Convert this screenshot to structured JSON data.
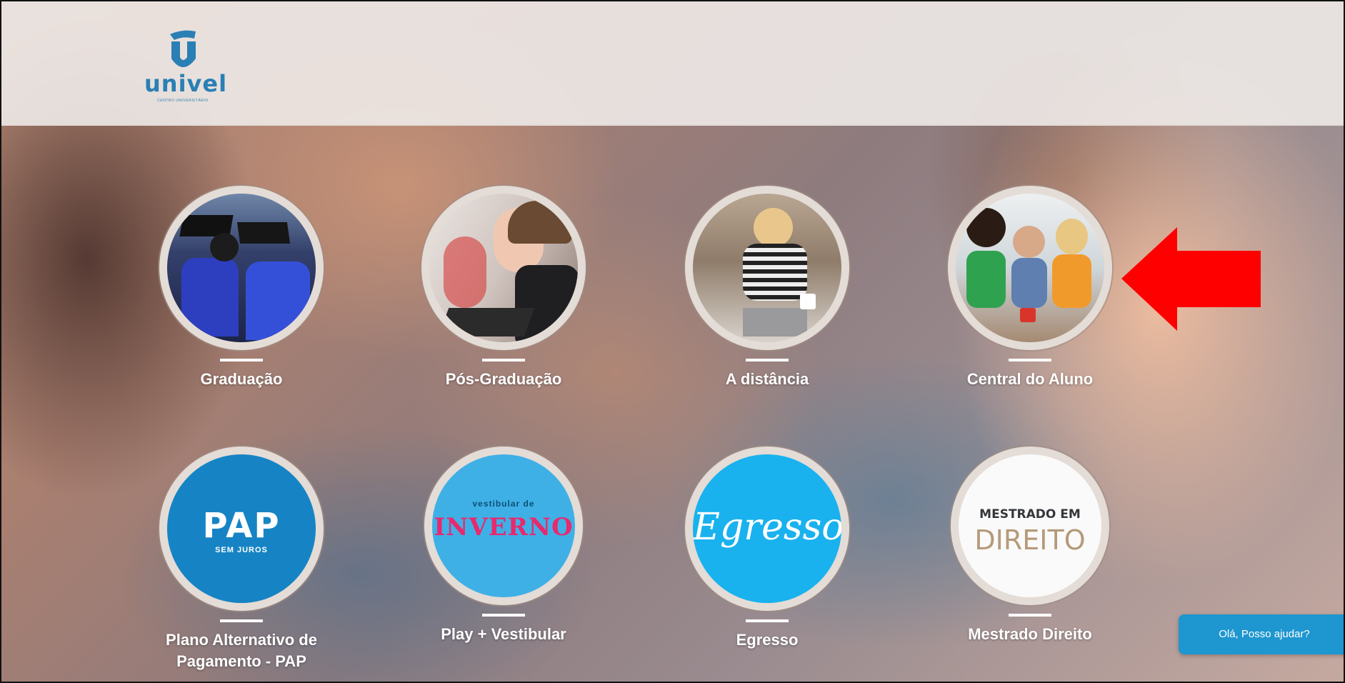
{
  "header": {
    "logo_text": "univel",
    "logo_subtext": "CENTRO UNIVERSITÁRIO"
  },
  "tiles": [
    {
      "label": "Graduação",
      "image": "graduates-photo"
    },
    {
      "label": "Pós-Graduação",
      "image": "studying-woman-photo"
    },
    {
      "label": "A distância",
      "image": "woman-laptop-photo"
    },
    {
      "label": "Central do Aluno",
      "image": "students-group-photo"
    },
    {
      "label": "Plano Alternativo de Pagamento - PAP",
      "image_text": "PAP",
      "image_subtext": "SEM JUROS"
    },
    {
      "label": "Play + Vestibular",
      "image_text": "INVERNO",
      "image_subtext": "vestibular de"
    },
    {
      "label": "Egresso",
      "image_text": "Egresso"
    },
    {
      "label": "Mestrado Direito",
      "image_text": "MESTRADO EM",
      "image_subtext": "DIREITO"
    }
  ],
  "chat": {
    "label": "Olá, Posso ajudar?"
  },
  "annotation": {
    "icon": "red-arrow-icon",
    "color": "#ff0000"
  },
  "colors": {
    "accent": "#1e96cf",
    "logo": "#2a7fb5",
    "pap": "#1684c4",
    "egresso": "#19b2ee"
  }
}
